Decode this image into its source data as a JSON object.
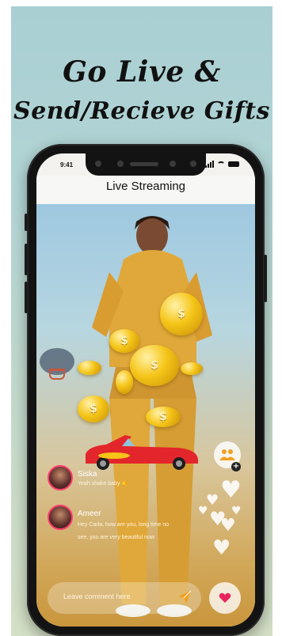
{
  "promo": {
    "headline_line1": "Go Live &",
    "headline_line2": "Send/Recieve Gifts"
  },
  "status_bar": {
    "time": "9:41"
  },
  "screen": {
    "title": "Live Streaming"
  },
  "comments": [
    {
      "user": "Siska",
      "text": "Yeah shake baby 🤙"
    },
    {
      "user": "Ameer",
      "text_line1": "Hey Carla, how are you, long time no",
      "text_line2": "see, you are very beautiful now"
    }
  ],
  "comment_input": {
    "placeholder": "Leave comment here"
  },
  "icons": {
    "send": "send-icon",
    "like": "heart-icon",
    "viewers": "users-icon",
    "add": "plus-icon",
    "gift": "coin-icon",
    "car_gift": "car-icon"
  },
  "colors": {
    "accent": "#f0a020",
    "like": "#e8245c",
    "avatar_ring": "#ff3d6e",
    "car": "#e2262b"
  }
}
